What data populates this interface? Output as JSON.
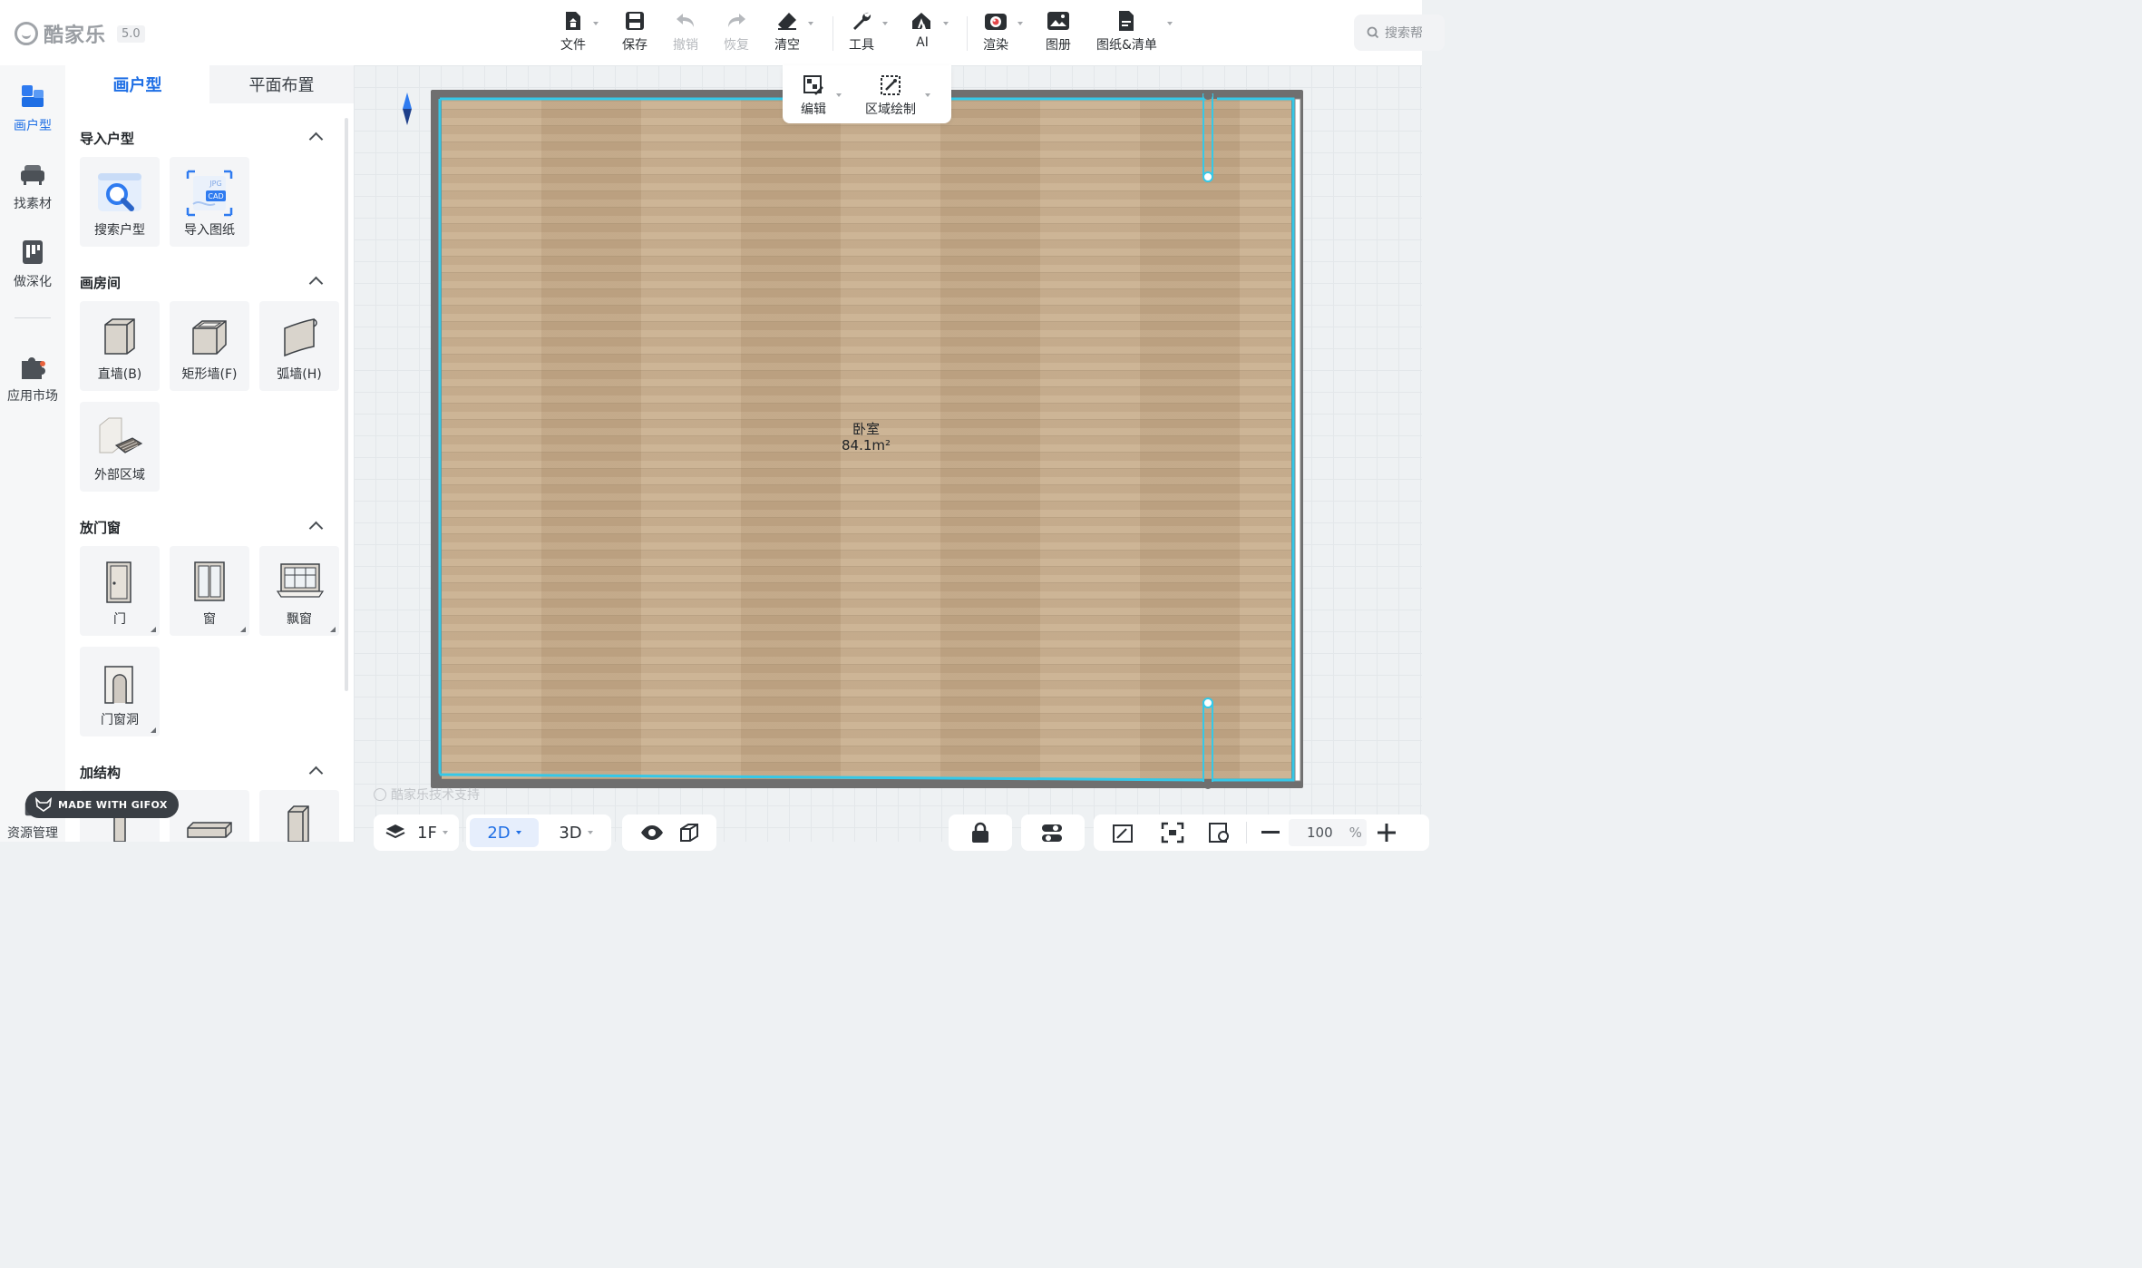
{
  "app": {
    "name": "酷家乐",
    "version": "5.0"
  },
  "toolbar": {
    "file": "文件",
    "save": "保存",
    "undo": "撤销",
    "redo": "恢复",
    "clear": "清空",
    "tools": "工具",
    "ai": "AI",
    "render": "渲染",
    "album": "图册",
    "drawings": "图纸&清单"
  },
  "search": {
    "placeholder": "搜索帮"
  },
  "leftnav": {
    "draw_floorplan": "画户型",
    "find_materials": "找素材",
    "deepen": "做深化",
    "app_market": "应用市场",
    "resource_mgmt": "资源管理"
  },
  "panel": {
    "tabs": {
      "draw": "画户型",
      "layout": "平面布置"
    },
    "sections": {
      "import": {
        "title": "导入户型",
        "items": [
          "搜索户型",
          "导入图纸"
        ]
      },
      "rooms": {
        "title": "画房间",
        "items": [
          "直墙(B)",
          "矩形墙(F)",
          "弧墙(H)",
          "外部区域"
        ]
      },
      "doors": {
        "title": "放门窗",
        "items": [
          "门",
          "窗",
          "飘窗",
          "门窗洞"
        ]
      },
      "structure": {
        "title": "加结构"
      }
    },
    "import_card_badges": {
      "jpg": "JPG",
      "cad": "CAD"
    }
  },
  "gifox": "MADE WITH GIFOX",
  "canvas": {
    "sub_toolbar": {
      "edit": "编辑",
      "region_draw": "区域绘制"
    },
    "room": {
      "name": "卧室",
      "area": "84.1m²"
    },
    "watermark": "酷家乐技术支持"
  },
  "bottombar": {
    "floor": "1F",
    "view2d": "2D",
    "view3d": "3D",
    "zoom_value": "100",
    "zoom_unit": "%"
  },
  "colors": {
    "accent": "#1f6fe5",
    "wall_highlight": "#35c8e8",
    "floor_wood": "#c6ab8a"
  }
}
